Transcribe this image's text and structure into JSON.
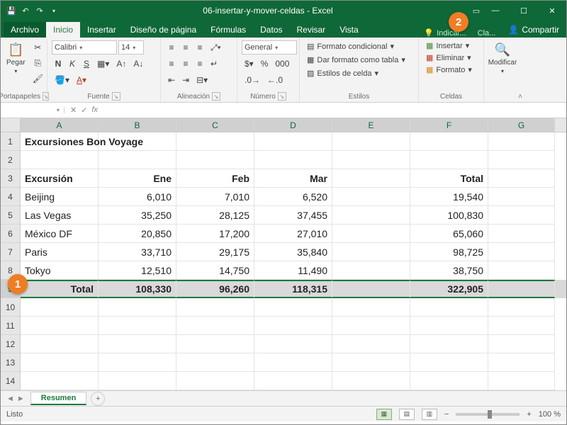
{
  "window": {
    "title": "06-insertar-y-mover-celdas - Excel"
  },
  "tabs": {
    "file": "Archivo",
    "home": "Inicio",
    "insert": "Insertar",
    "layout": "Diseño de página",
    "formulas": "Fórmulas",
    "data": "Datos",
    "review": "Revisar",
    "view": "Vista",
    "tell": "Indicar...",
    "signin_prefix": "In...",
    "signin": "Cla...",
    "share": "Compartir"
  },
  "ribbon": {
    "clipboard": {
      "paste": "Pegar",
      "label": "Portapapeles"
    },
    "font": {
      "name": "Calibri",
      "size": "14",
      "label": "Fuente",
      "bold": "N",
      "italic": "K",
      "underline": "S"
    },
    "alignment": {
      "label": "Alineación"
    },
    "number": {
      "format": "General",
      "label": "Número"
    },
    "styles": {
      "cond": "Formato condicional",
      "astable": "Dar formato como tabla",
      "cellstyles": "Estilos de celda",
      "label": "Estilos"
    },
    "cells": {
      "insert": "Insertar",
      "delete": "Eliminar",
      "format": "Formato",
      "label": "Celdas"
    },
    "editing": {
      "findsel": "Modificar",
      "label": ""
    }
  },
  "formula_bar": {
    "namebox": "",
    "fx": "fx"
  },
  "columns": [
    "A",
    "B",
    "C",
    "D",
    "E",
    "F",
    "G"
  ],
  "rows": [
    "1",
    "2",
    "3",
    "4",
    "5",
    "6",
    "7",
    "8",
    "9",
    "10",
    "11",
    "12",
    "13",
    "14"
  ],
  "selected_row": "9",
  "sheet": {
    "title": "Excursiones Bon Voyage",
    "headers": {
      "tour": "Excursión",
      "jan": "Ene",
      "feb": "Feb",
      "mar": "Mar",
      "total": "Total"
    },
    "data": [
      {
        "name": "Beijing",
        "jan": "6,010",
        "feb": "7,010",
        "mar": "6,520",
        "total": "19,540"
      },
      {
        "name": "Las Vegas",
        "jan": "35,250",
        "feb": "28,125",
        "mar": "37,455",
        "total": "100,830"
      },
      {
        "name": "México DF",
        "jan": "20,850",
        "feb": "17,200",
        "mar": "27,010",
        "total": "65,060"
      },
      {
        "name": "Paris",
        "jan": "33,710",
        "feb": "29,175",
        "mar": "35,840",
        "total": "98,725"
      },
      {
        "name": "Tokyo",
        "jan": "12,510",
        "feb": "14,750",
        "mar": "11,490",
        "total": "38,750"
      }
    ],
    "totals": {
      "label": "Total",
      "jan": "108,330",
      "feb": "96,260",
      "mar": "118,315",
      "grand": "322,905"
    }
  },
  "sheet_tab": "Resumen",
  "status": {
    "ready": "Listo",
    "zoom": "100 %"
  },
  "callouts": {
    "one": "1",
    "two": "2"
  }
}
